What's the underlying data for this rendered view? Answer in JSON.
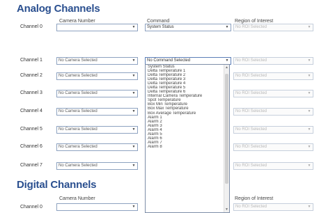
{
  "analog": {
    "title": "Analog Channels",
    "headers": {
      "camera": "Camera Number",
      "command": "Command",
      "roi": "Region of Interest"
    },
    "rows": [
      {
        "label": "Channel 0",
        "camera": "",
        "command": "System Status",
        "roi": "No ROI Selected"
      },
      {
        "label": "Channel 1",
        "camera": "No Camera Selected",
        "command": "No Command Selected",
        "roi": "No ROI Selected"
      },
      {
        "label": "Channel 2",
        "camera": "No Camera Selected",
        "command": "",
        "roi": "No ROI Selected"
      },
      {
        "label": "Channel 3",
        "camera": "No Camera Selected",
        "command": "",
        "roi": "No ROI Selected"
      },
      {
        "label": "Channel 4",
        "camera": "No Camera Selected",
        "command": "",
        "roi": "No ROI Selected"
      },
      {
        "label": "Channel 5",
        "camera": "No Camera Selected",
        "command": "",
        "roi": "No ROI Selected"
      },
      {
        "label": "Channel 6",
        "camera": "No Camera Selected",
        "command": "",
        "roi": "No ROI Selected"
      },
      {
        "label": "Channel 7",
        "camera": "No Camera Selected",
        "command": "",
        "roi": "No ROI Selected"
      }
    ]
  },
  "command_dropdown": {
    "options": [
      "System Status",
      "Delta Temperature 1",
      "Delta Temperature 2",
      "Delta Temperature 3",
      "Delta Temperature 4",
      "Delta Temperature 5",
      "Delta Temperature 6",
      "Internal Camera Temperature",
      "Spot Temperature",
      "Box Min Temperature",
      "Box Max Temperature",
      "Box Average Temperature",
      "Alarm 1",
      "Alarm 2",
      "Alarm 3",
      "Alarm 4",
      "Alarm 5",
      "Alarm 6",
      "Alarm 7",
      "Alarm 8"
    ]
  },
  "digital": {
    "title": "Digital Channels",
    "headers": {
      "camera": "Camera Number",
      "roi": "Region of Interest"
    },
    "rows": [
      {
        "label": "Channel 0",
        "camera": "",
        "roi": "No ROI Selected"
      }
    ]
  },
  "icons": {
    "select_arrow": "chevron-down-icon",
    "scroll_up": "scroll-up-arrow-icon",
    "scroll_down": "scroll-down-arrow-icon"
  }
}
